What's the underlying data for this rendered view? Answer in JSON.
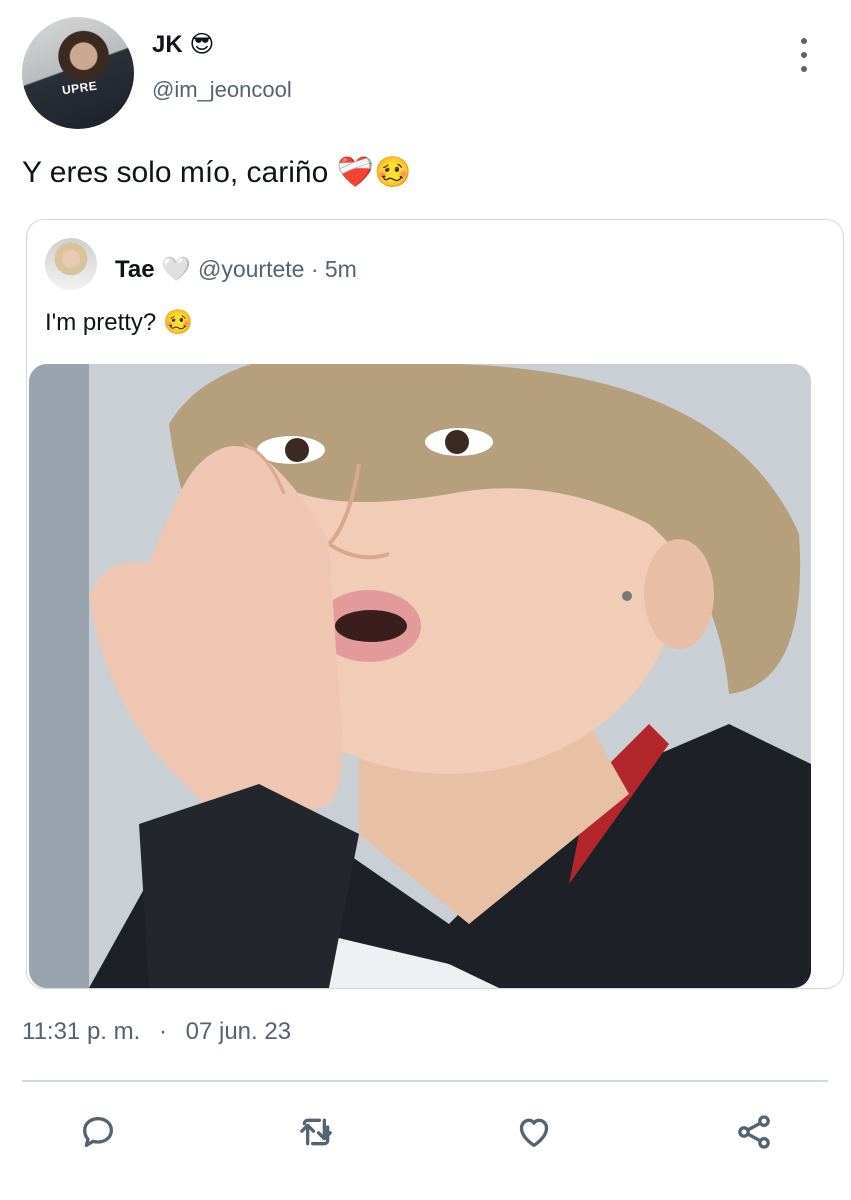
{
  "author": {
    "display_name": "JK",
    "name_emoji": "😎",
    "handle": "@im_jeoncool",
    "avatar_shirt_text": "UPRE"
  },
  "tweet": {
    "text": "Y eres solo mío, cariño",
    "emojis": "❤️‍🩹🥴"
  },
  "quoted_tweet": {
    "display_name": "Tae",
    "name_emoji": "🤍",
    "handle_time": "@yourtete · 5m",
    "text": "I'm pretty?",
    "text_emoji": "🥴"
  },
  "meta": {
    "time": "11:31 p. m.",
    "separator": "·",
    "date": "07 jun. 23"
  },
  "actions": [
    {
      "icon": "reply-icon"
    },
    {
      "icon": "retweet-icon"
    },
    {
      "icon": "like-icon"
    },
    {
      "icon": "share-icon"
    }
  ],
  "colors": {
    "primary_text": "#0f1419",
    "secondary_text": "#536471",
    "border": "#cfd9de"
  }
}
